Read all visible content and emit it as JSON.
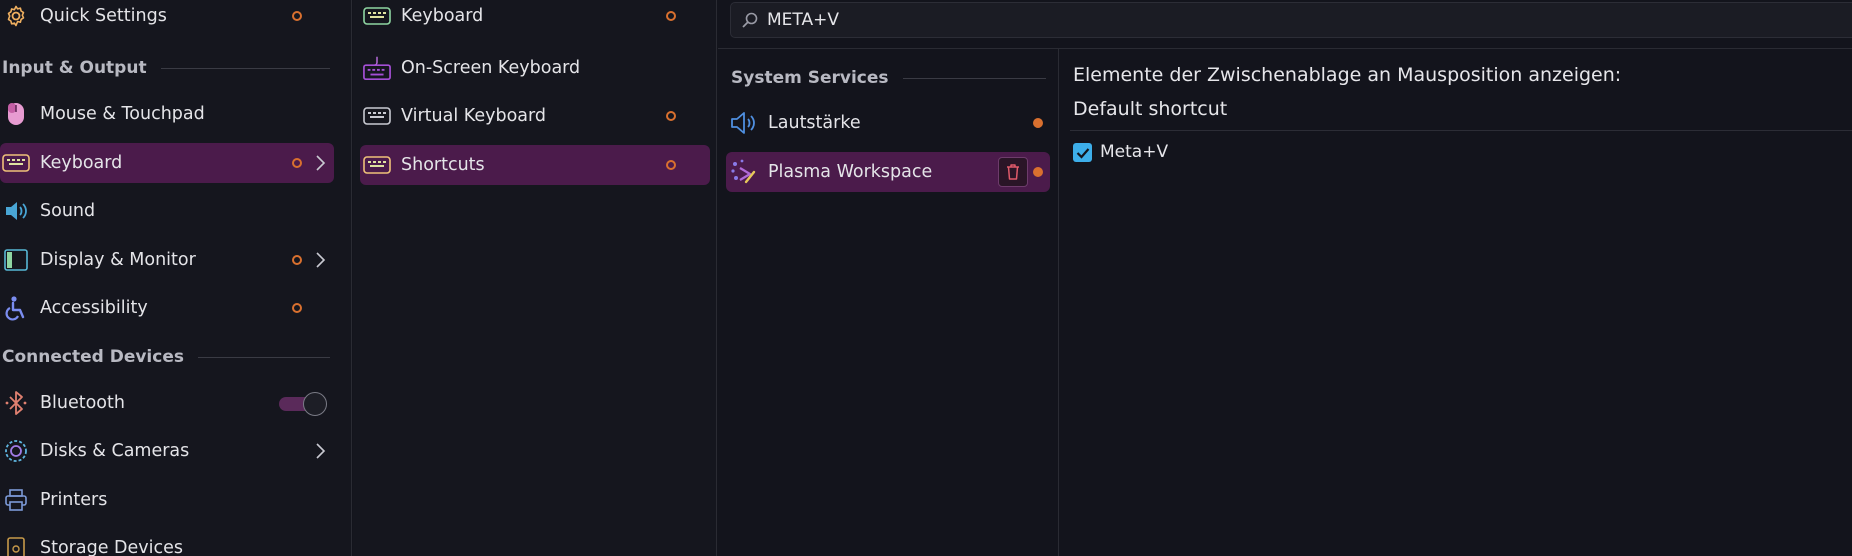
{
  "sidebar": {
    "items": [
      {
        "label": "Quick Settings",
        "icon": "gear-icon"
      },
      {
        "label": "Mouse & Touchpad",
        "icon": "mouse-icon"
      },
      {
        "label": "Keyboard",
        "icon": "keyboard-icon"
      },
      {
        "label": "Sound",
        "icon": "speaker-icon"
      },
      {
        "label": "Display & Monitor",
        "icon": "display-icon"
      },
      {
        "label": "Accessibility",
        "icon": "accessibility-icon"
      },
      {
        "label": "Bluetooth",
        "icon": "bluetooth-icon"
      },
      {
        "label": "Disks & Cameras",
        "icon": "disk-icon"
      },
      {
        "label": "Printers",
        "icon": "printer-icon"
      },
      {
        "label": "Storage Devices",
        "icon": "storage-icon"
      }
    ],
    "sections": [
      "Input & Output",
      "Connected Devices"
    ],
    "selected": "Keyboard",
    "bluetooth_enabled": true
  },
  "subnav": {
    "items": [
      {
        "label": "Keyboard",
        "icon": "keyboard-icon"
      },
      {
        "label": "On-Screen Keyboard",
        "icon": "onscreen-keyboard-icon"
      },
      {
        "label": "Virtual Keyboard",
        "icon": "virtual-keyboard-icon"
      },
      {
        "label": "Shortcuts",
        "icon": "shortcuts-keyboard-icon"
      }
    ],
    "selected": "Shortcuts"
  },
  "search": {
    "value": "META+V",
    "icon": "search-icon"
  },
  "services": {
    "section": "System Services",
    "items": [
      {
        "label": "Lautstärke",
        "icon": "volume-icon"
      },
      {
        "label": "Plasma Workspace",
        "icon": "plasma-icon"
      }
    ],
    "selected": "Plasma Workspace"
  },
  "detail": {
    "title": "Elemente der Zwischenablage an Mausposition anzeigen:",
    "subtitle": "Default shortcut",
    "shortcut_label": "Meta+V",
    "shortcut_checked": true
  },
  "colors": {
    "accent": "#4b1b4b",
    "modified_dot": "#d9702f",
    "checkbox": "#3daee9",
    "background": "#13141c"
  }
}
